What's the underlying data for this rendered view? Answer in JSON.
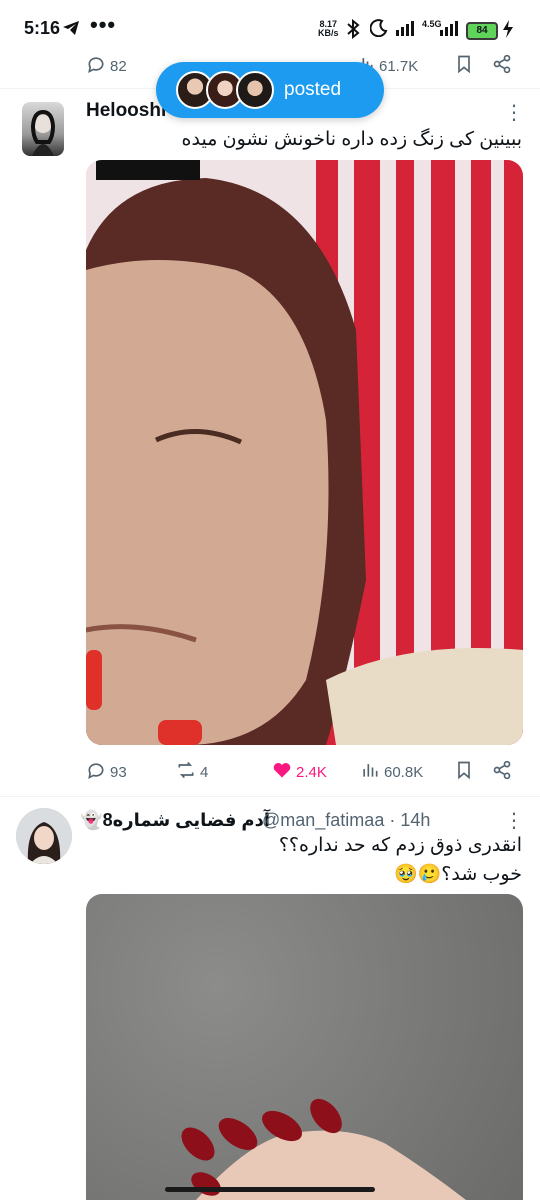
{
  "status_bar": {
    "time": "5:16",
    "dots": "•••",
    "speed_value": "8.17",
    "speed_unit": "KB/s",
    "network": "4.5G",
    "battery": "84"
  },
  "prev_tweet": {
    "replies": "82",
    "views": "61.7K"
  },
  "posted_pill": {
    "label": "posted"
  },
  "tweet1": {
    "name": "Helooshi",
    "text": "ببینین کی زنگ زده داره ناخونش نشون میده",
    "replies": "93",
    "retweets": "4",
    "likes": "2.4K",
    "views": "60.8K",
    "like_color": "#f91880"
  },
  "tweet2": {
    "name": "آدم فضایی شماره8👻",
    "handle": "@man_fatimaa · 14h",
    "text_line1": "انقدری ذوق زدم که حد نداره؟؟",
    "text_line2": "خوب شد؟🥲🥹"
  },
  "icons": [
    "telegram-icon",
    "bluetooth-icon",
    "moon-icon",
    "signal-icon",
    "charging-icon",
    "reply-icon",
    "retweet-icon",
    "like-icon",
    "views-icon",
    "bookmark-icon",
    "share-icon",
    "more-icon",
    "arrow-up-icon"
  ]
}
